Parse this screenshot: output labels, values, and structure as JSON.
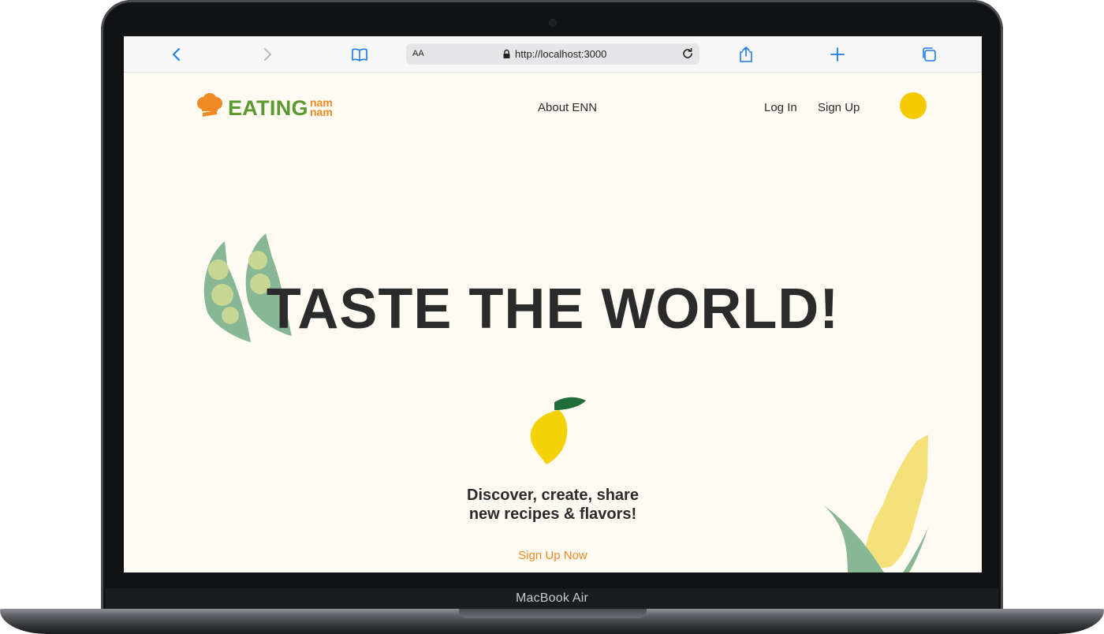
{
  "device": {
    "label": "MacBook Air"
  },
  "browser": {
    "address_aa": "AA",
    "url": "http://localhost:3000"
  },
  "site": {
    "logo_main": "EATING",
    "logo_sub_1": "nam",
    "logo_sub_2": "nam",
    "nav": {
      "about": "About ENN",
      "login": "Log In",
      "signup": "Sign Up"
    },
    "hero_title": "TASTE THE WORLD!",
    "tagline_line1": "Discover, create, share",
    "tagline_line2": "new recipes & flavors!",
    "cta": "Sign Up Now"
  },
  "colors": {
    "page_background": "#fffbf2",
    "brand_green": "#5a9a2f",
    "brand_orange": "#f08a24",
    "accent_yellow": "#f6c900",
    "text_dark": "#2b2b2b"
  }
}
